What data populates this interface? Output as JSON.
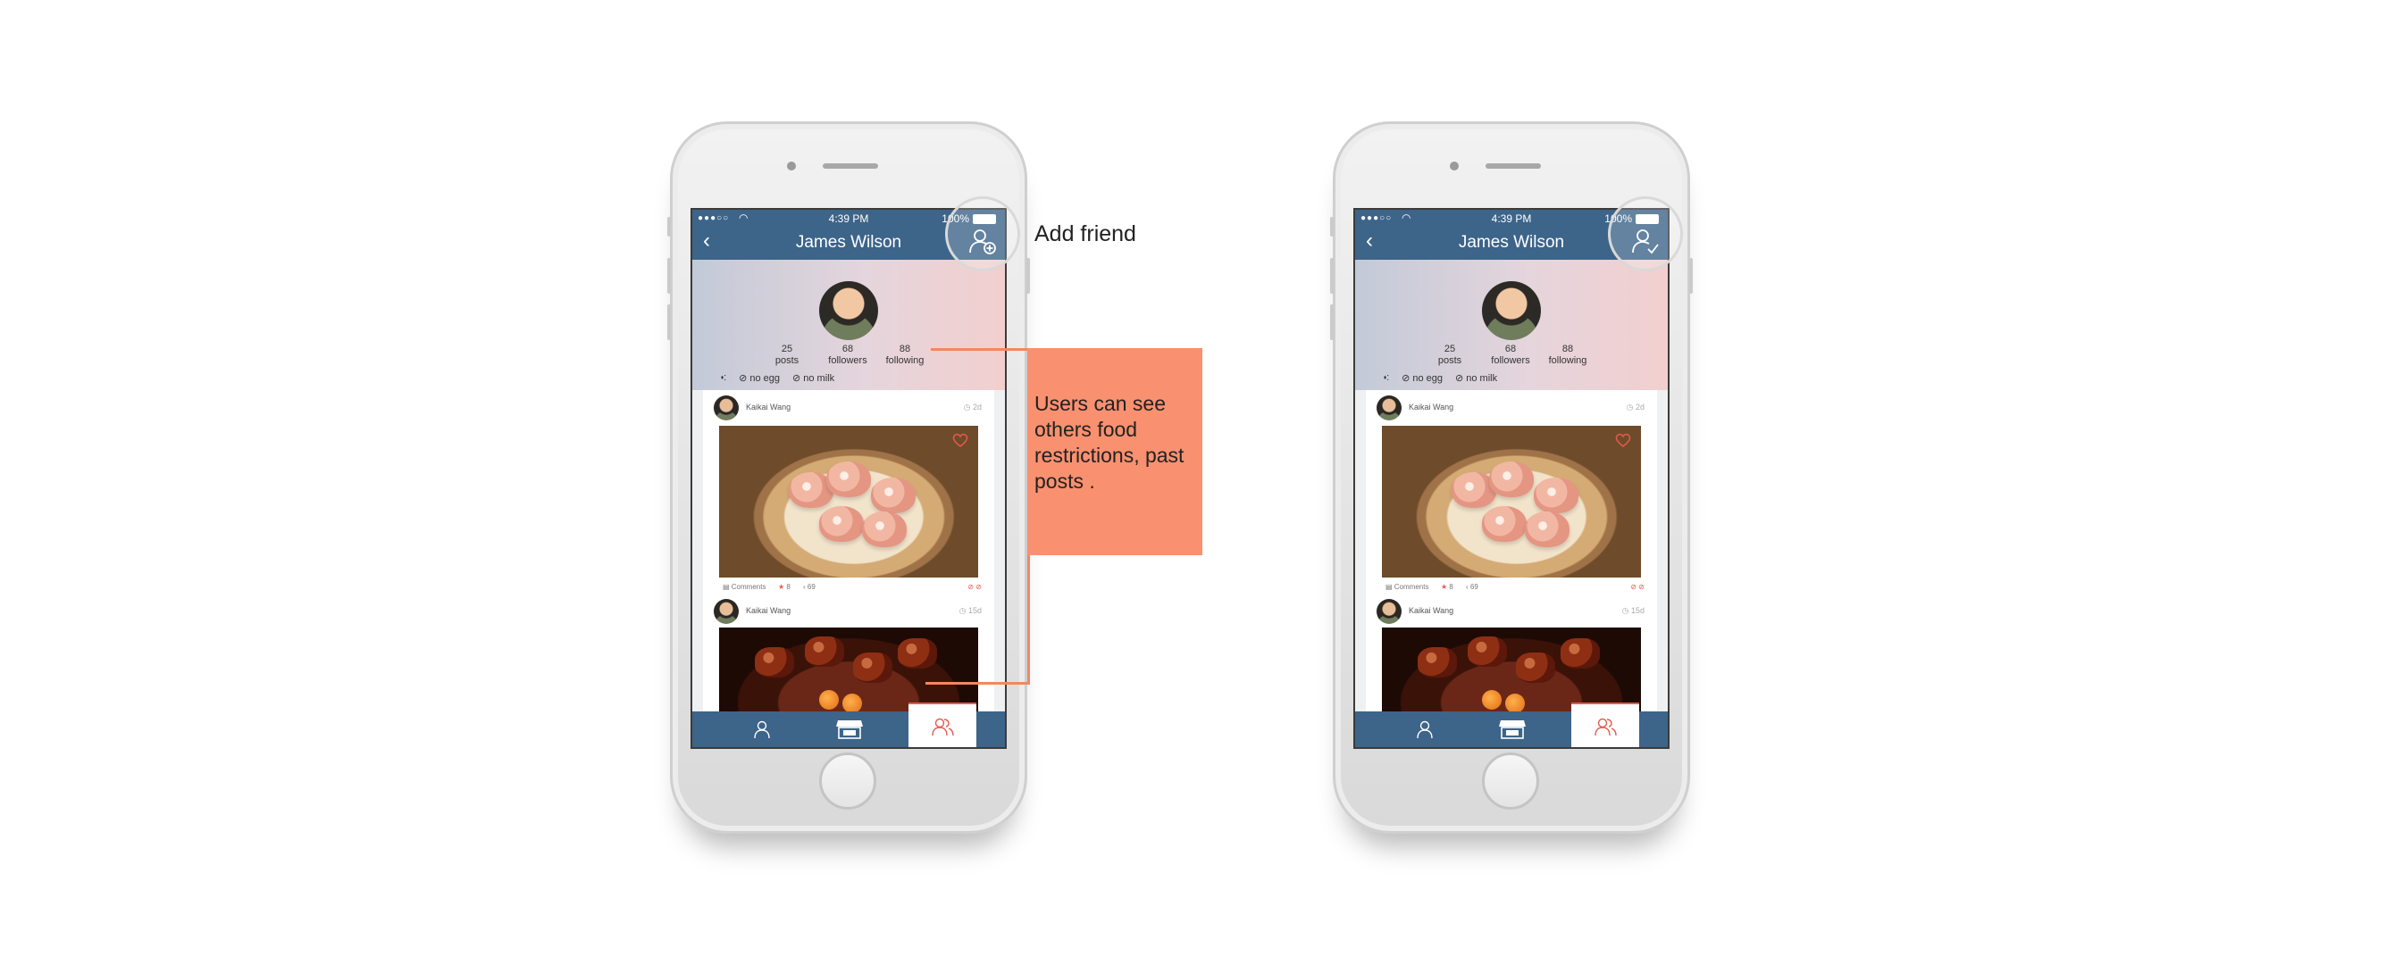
{
  "accent_color": "#3d6489",
  "highlight_color": "#e55a4e",
  "annotation_color": "#f9906f",
  "annotations": {
    "add_friend": "Add friend",
    "restrictions_note": "Users can see others food restrictions, past posts ."
  },
  "phones": [
    {
      "status": {
        "time": "4:39 PM",
        "battery": "100%"
      },
      "nav": {
        "title": "James Wilson",
        "action_icon": "add-friend-icon"
      },
      "profile": {
        "posts_count": "25",
        "posts_label": "posts",
        "followers_count": "68",
        "followers_label": "followers",
        "following_count": "88",
        "following_label": "following",
        "restrictions": [
          "no egg",
          "no milk"
        ]
      },
      "posts": [
        {
          "author": "Kaikai Wang",
          "age": "2d",
          "comments_label": "Comments",
          "likes": "8",
          "shares": "69"
        },
        {
          "author": "Kaikai Wang",
          "age": "15d"
        }
      ]
    },
    {
      "status": {
        "time": "4:39 PM",
        "battery": "100%"
      },
      "nav": {
        "title": "James Wilson",
        "action_icon": "friend-added-icon"
      },
      "profile": {
        "posts_count": "25",
        "posts_label": "posts",
        "followers_count": "68",
        "followers_label": "followers",
        "following_count": "88",
        "following_label": "following",
        "restrictions": [
          "no egg",
          "no milk"
        ]
      },
      "posts": [
        {
          "author": "Kaikai Wang",
          "age": "2d",
          "comments_label": "Comments",
          "likes": "8",
          "shares": "69"
        },
        {
          "author": "Kaikai Wang",
          "age": "15d"
        }
      ]
    }
  ],
  "tabbar": {
    "tabs": [
      "profile-tab",
      "store-tab",
      "friends-tab"
    ],
    "active": "friends-tab"
  }
}
